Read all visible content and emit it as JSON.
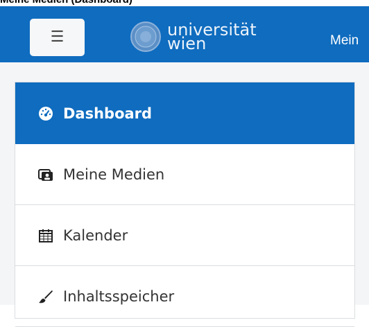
{
  "page": {
    "caption": "Meine Medien (Dashboard)"
  },
  "navbar": {
    "logo_line1": "universität",
    "logo_line2": "wien",
    "title": "Mein",
    "menu_icon": "hamburger-icon",
    "color": "#0f6cbf"
  },
  "sidebar": {
    "items": [
      {
        "label": "Dashboard",
        "icon": "dashboard-gauge-icon",
        "active": true
      },
      {
        "label": "Meine Medien",
        "icon": "media-gallery-icon",
        "active": false
      },
      {
        "label": "Kalender",
        "icon": "calendar-icon",
        "active": false
      },
      {
        "label": "Inhaltsspeicher",
        "icon": "paintbrush-icon",
        "active": false
      }
    ]
  },
  "colors": {
    "accent": "#0f6cbf",
    "sidebar_border": "#dadde0",
    "page_background": "#f4f5f6"
  }
}
